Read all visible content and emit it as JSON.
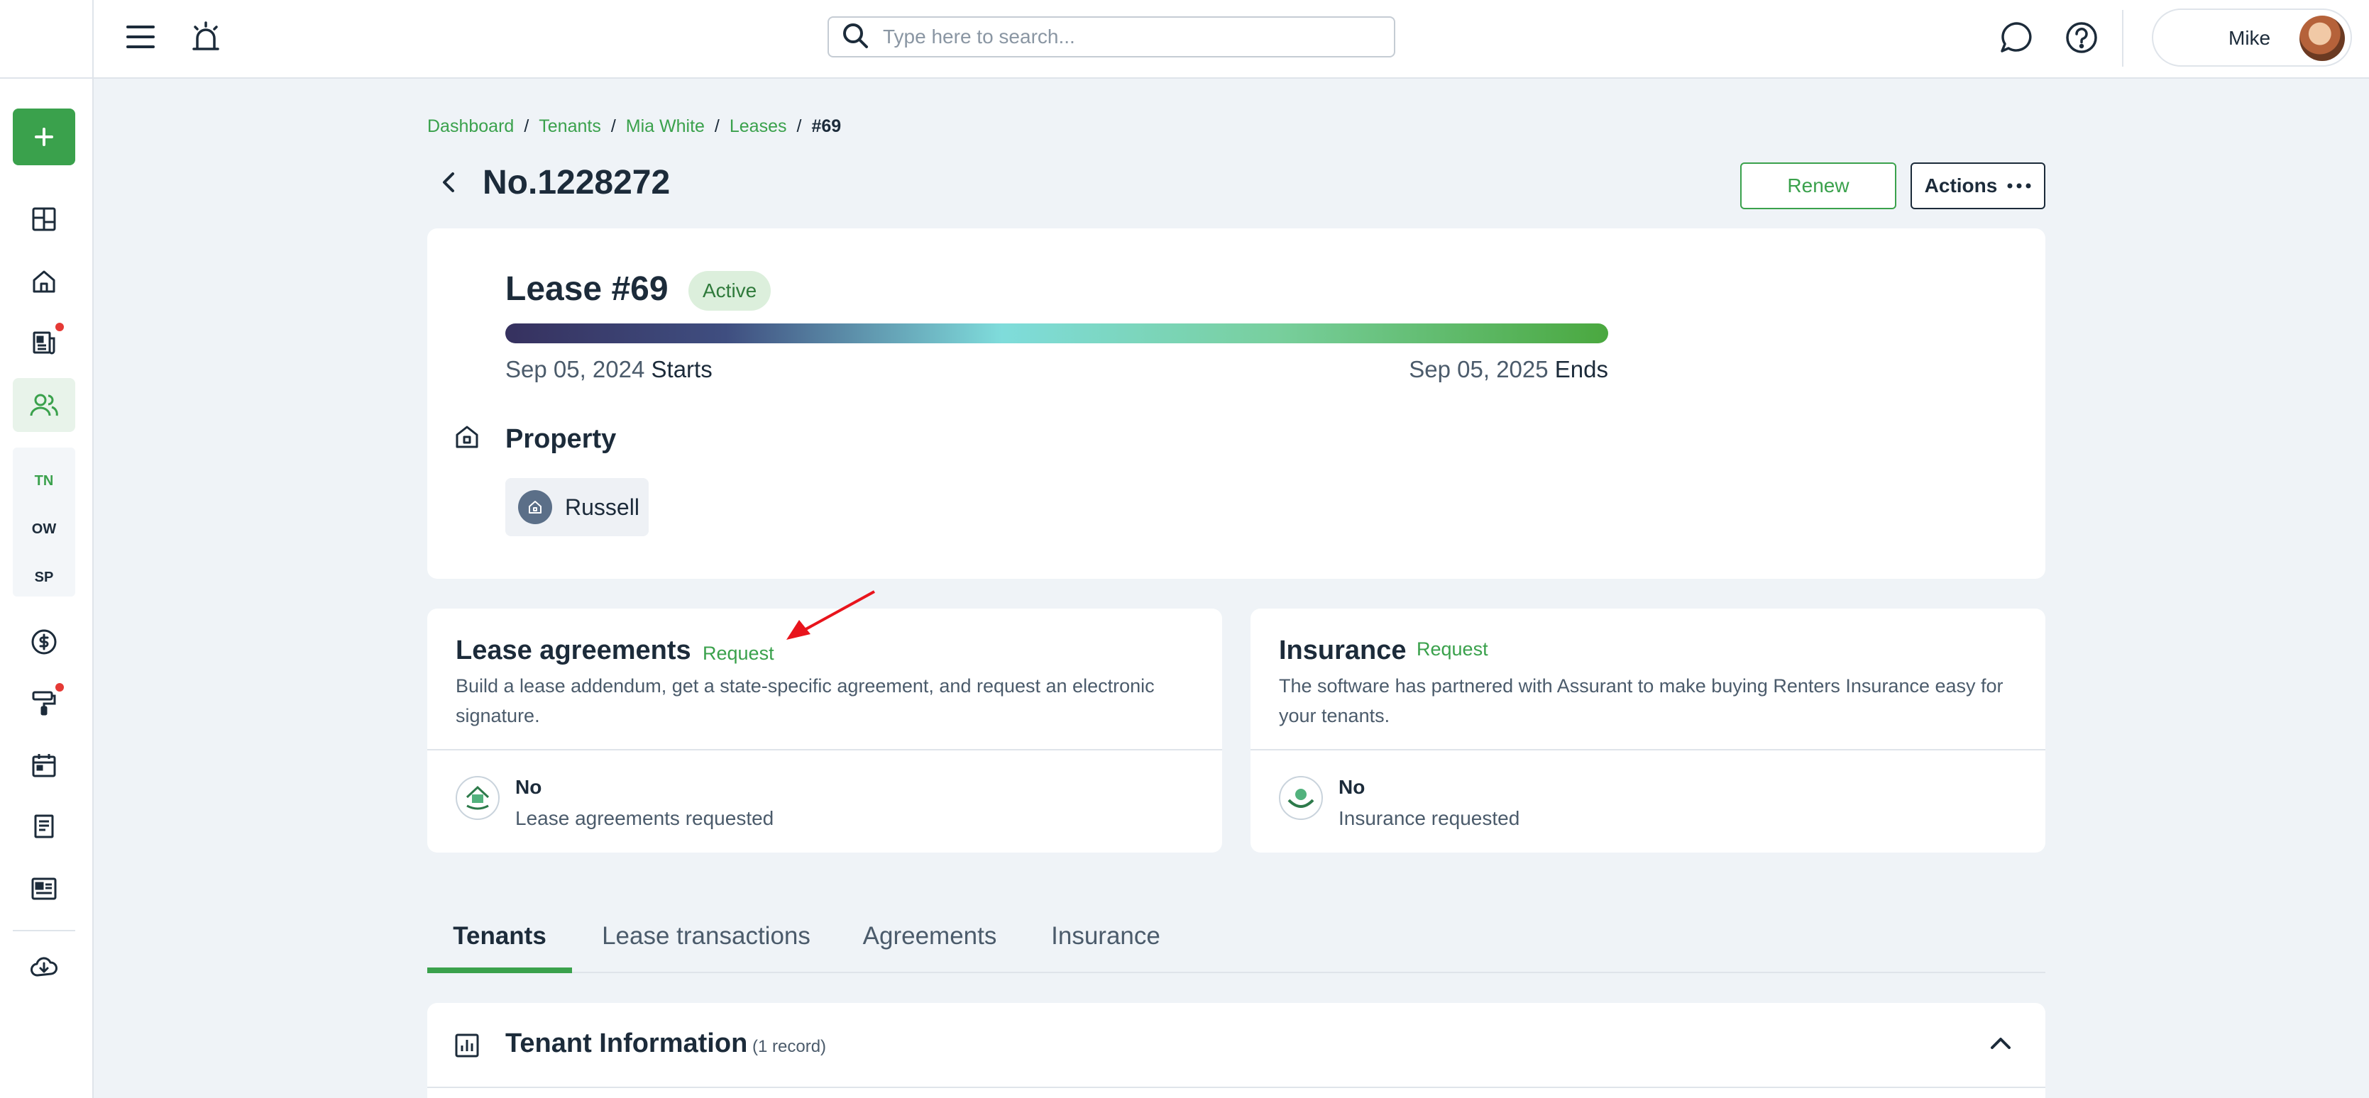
{
  "topbar": {
    "search_placeholder": "Type here to search...",
    "user_name": "Mike"
  },
  "sidebar": {
    "sub_items": [
      "TN",
      "OW",
      "SP"
    ]
  },
  "breadcrumb": {
    "items": [
      "Dashboard",
      "Tenants",
      "Mia White",
      "Leases"
    ],
    "current": "#69",
    "separator": "/"
  },
  "page": {
    "title": "No.1228272",
    "renew_label": "Renew",
    "actions_label": "Actions"
  },
  "lease": {
    "title": "Lease #69",
    "status": "Active",
    "start_date": "Sep 05, 2024",
    "start_word": "Starts",
    "end_date": "Sep 05, 2025",
    "end_word": "Ends",
    "property_label": "Property",
    "property_name": "Russell"
  },
  "lease_agreements": {
    "title": "Lease agreements",
    "request_label": "Request",
    "description": "Build a lease addendum, get a state-specific agreement, and request an electronic signature.",
    "status": "No",
    "status_sub": "Lease agreements requested"
  },
  "insurance": {
    "title": "Insurance",
    "request_label": "Request",
    "description": "The software has partnered with Assurant to make buying Renters Insurance easy for your tenants.",
    "status": "No",
    "status_sub": "Insurance requested"
  },
  "tabs": [
    "Tenants",
    "Lease transactions",
    "Agreements",
    "Insurance"
  ],
  "tenant_info": {
    "title": "Tenant Information",
    "count": "(1 record)"
  },
  "colors": {
    "accent": "#3aa14c",
    "text": "#1c2b3a",
    "background": "#eff3f7",
    "alert_dot": "#e53935"
  }
}
